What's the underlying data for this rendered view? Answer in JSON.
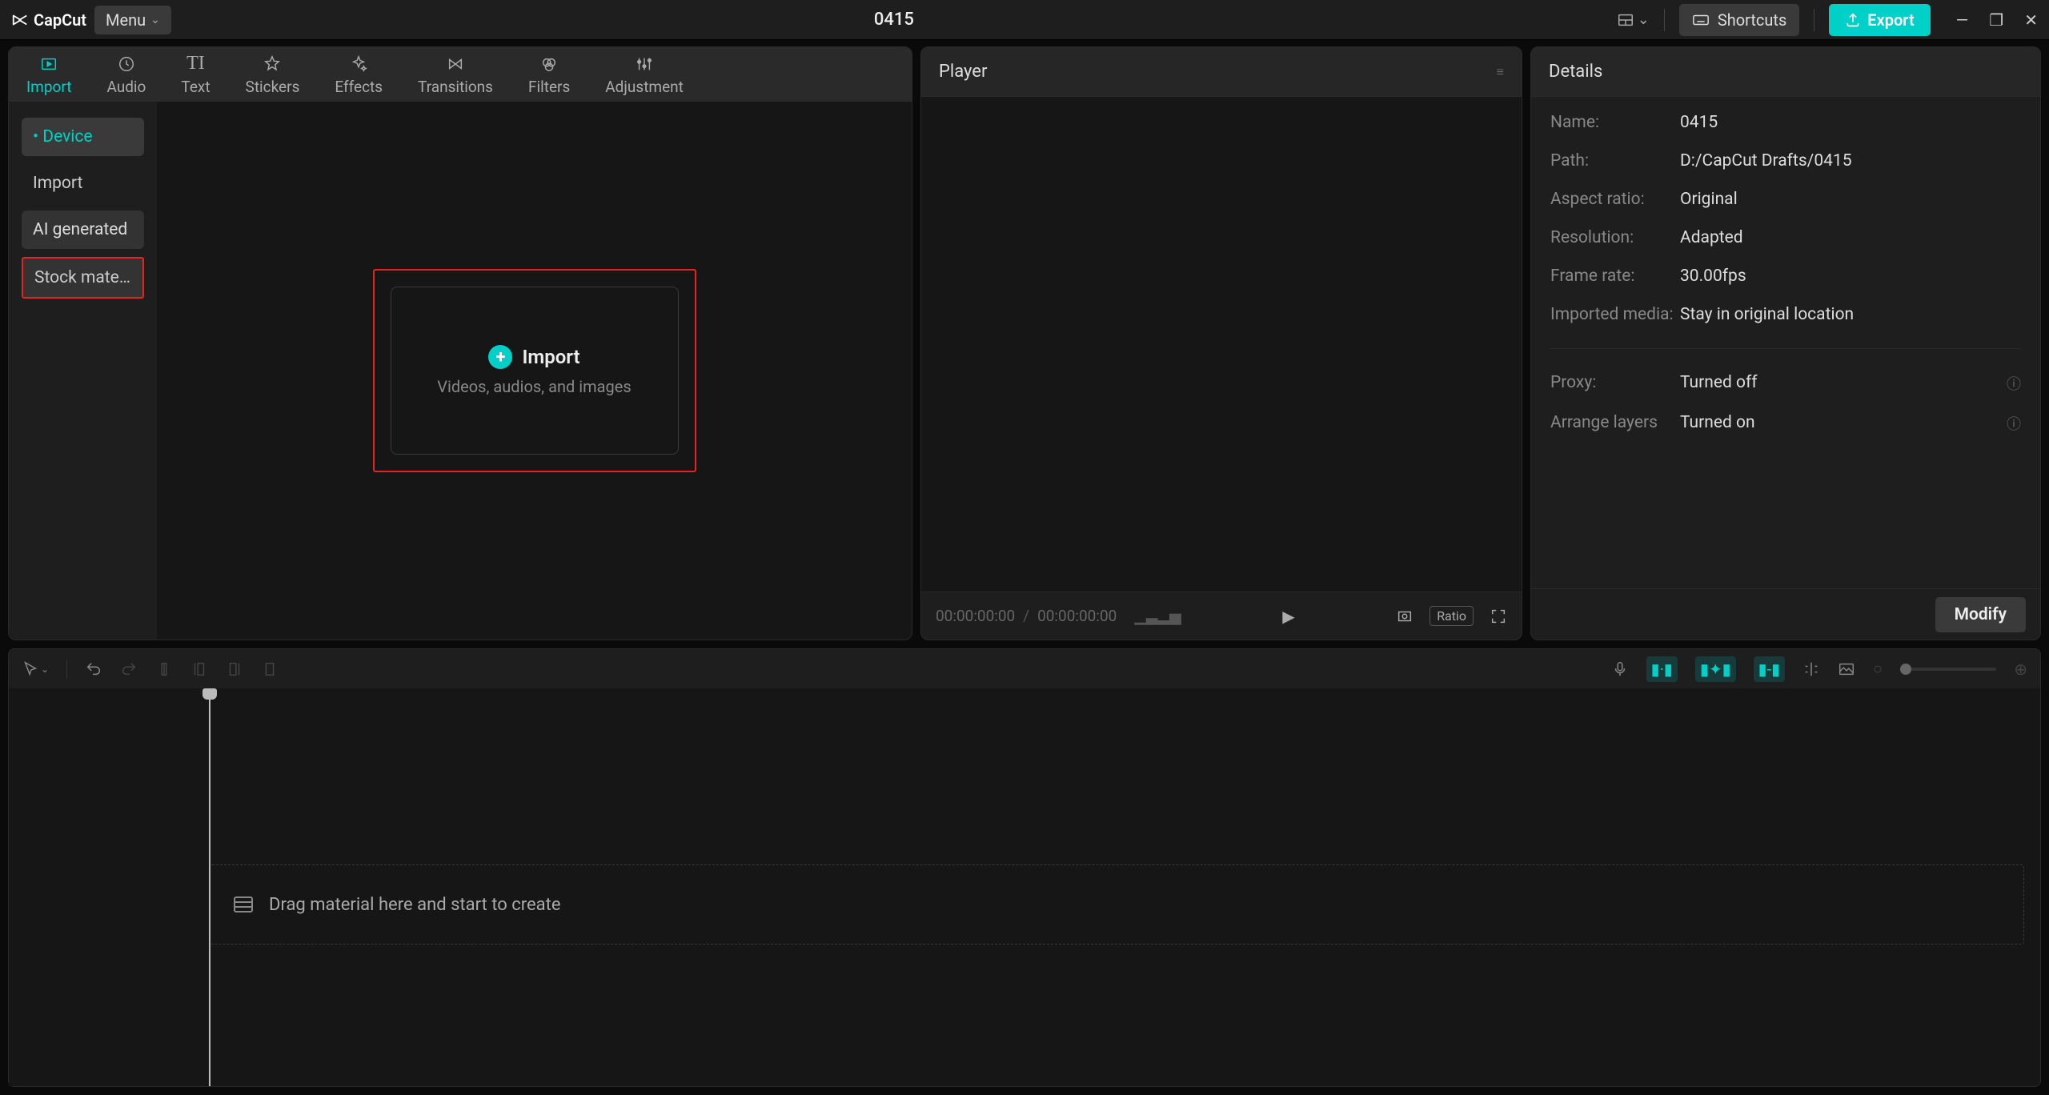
{
  "app": {
    "name": "CapCut",
    "menu": "Menu"
  },
  "project": {
    "title": "0415"
  },
  "titlebar": {
    "shortcuts": "Shortcuts",
    "export": "Export"
  },
  "mediaTabs": [
    {
      "id": "import",
      "label": "Import"
    },
    {
      "id": "audio",
      "label": "Audio"
    },
    {
      "id": "text",
      "label": "Text"
    },
    {
      "id": "stickers",
      "label": "Stickers"
    },
    {
      "id": "effects",
      "label": "Effects"
    },
    {
      "id": "transitions",
      "label": "Transitions"
    },
    {
      "id": "filters",
      "label": "Filters"
    },
    {
      "id": "adjustment",
      "label": "Adjustment"
    }
  ],
  "sidebar": {
    "device": "Device",
    "import": "Import",
    "ai": "AI generated",
    "stock": "Stock mater..."
  },
  "importCard": {
    "title": "Import",
    "subtitle": "Videos, audios, and images"
  },
  "player": {
    "title": "Player",
    "timecode_current": "00:00:00:00",
    "timecode_total": "00:00:00:00",
    "ratio_label": "Ratio"
  },
  "details": {
    "title": "Details",
    "rows": {
      "name_label": "Name:",
      "name_value": "0415",
      "path_label": "Path:",
      "path_value": "D:/CapCut Drafts/0415",
      "aspect_label": "Aspect ratio:",
      "aspect_value": "Original",
      "resolution_label": "Resolution:",
      "resolution_value": "Adapted",
      "framerate_label": "Frame rate:",
      "framerate_value": "30.00fps",
      "imported_label": "Imported media:",
      "imported_value": "Stay in original location",
      "proxy_label": "Proxy:",
      "proxy_value": "Turned off",
      "layers_label": "Arrange layers",
      "layers_value": "Turned on"
    },
    "modify": "Modify"
  },
  "timeline": {
    "drop_hint": "Drag material here and start to create"
  }
}
